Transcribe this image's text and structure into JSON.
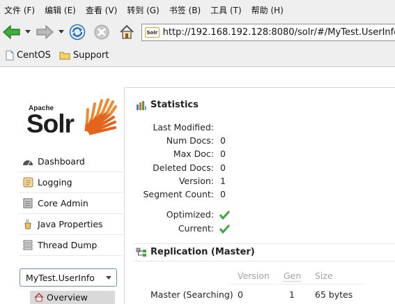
{
  "menu": [
    "文件 (F)",
    "编辑 (E)",
    "查看 (V)",
    "转到 (G)",
    "书签 (B)",
    "工具 (T)",
    "帮助 (H)"
  ],
  "address": {
    "favicon_text": "Solr",
    "url": "http://192.168.192.128:8080/solr/#/MyTest.UserInfo"
  },
  "bookmarks": [
    {
      "label": "CentOS",
      "icon": "page-icon"
    },
    {
      "label": "Support",
      "icon": "folder-icon"
    }
  ],
  "logo": {
    "apache": "Apache",
    "solr": "Solr"
  },
  "sidenav": [
    {
      "label": "Dashboard",
      "icon": "dashboard-icon"
    },
    {
      "label": "Logging",
      "icon": "logging-icon"
    },
    {
      "label": "Core Admin",
      "icon": "core-admin-icon"
    },
    {
      "label": "Java Properties",
      "icon": "java-properties-icon"
    },
    {
      "label": "Thread Dump",
      "icon": "thread-dump-icon"
    }
  ],
  "core_selector": {
    "selected": "MyTest.UserInfo"
  },
  "core_menu": {
    "overview": "Overview"
  },
  "statistics": {
    "title": "Statistics",
    "rows": [
      {
        "label": "Last Modified:",
        "value": ""
      },
      {
        "label": "Num Docs:",
        "value": "0"
      },
      {
        "label": "Max Doc:",
        "value": "0"
      },
      {
        "label": "Deleted Docs:",
        "value": "0"
      },
      {
        "label": "Version:",
        "value": "1"
      },
      {
        "label": "Segment Count:",
        "value": "0"
      }
    ],
    "flags": [
      {
        "label": "Optimized:",
        "checked": true
      },
      {
        "label": "Current:",
        "checked": true
      }
    ]
  },
  "replication": {
    "title": "Replication (Master)",
    "headers": [
      "Version",
      "Gen",
      "Size"
    ],
    "rows": [
      {
        "name": "Master (Searching)",
        "version": "0",
        "gen": "1",
        "size": "65 bytes"
      }
    ]
  },
  "colors": {
    "accent_green": "#3da53d",
    "solr_orange": "#e3641c",
    "select_border": "#6d8fc0"
  }
}
